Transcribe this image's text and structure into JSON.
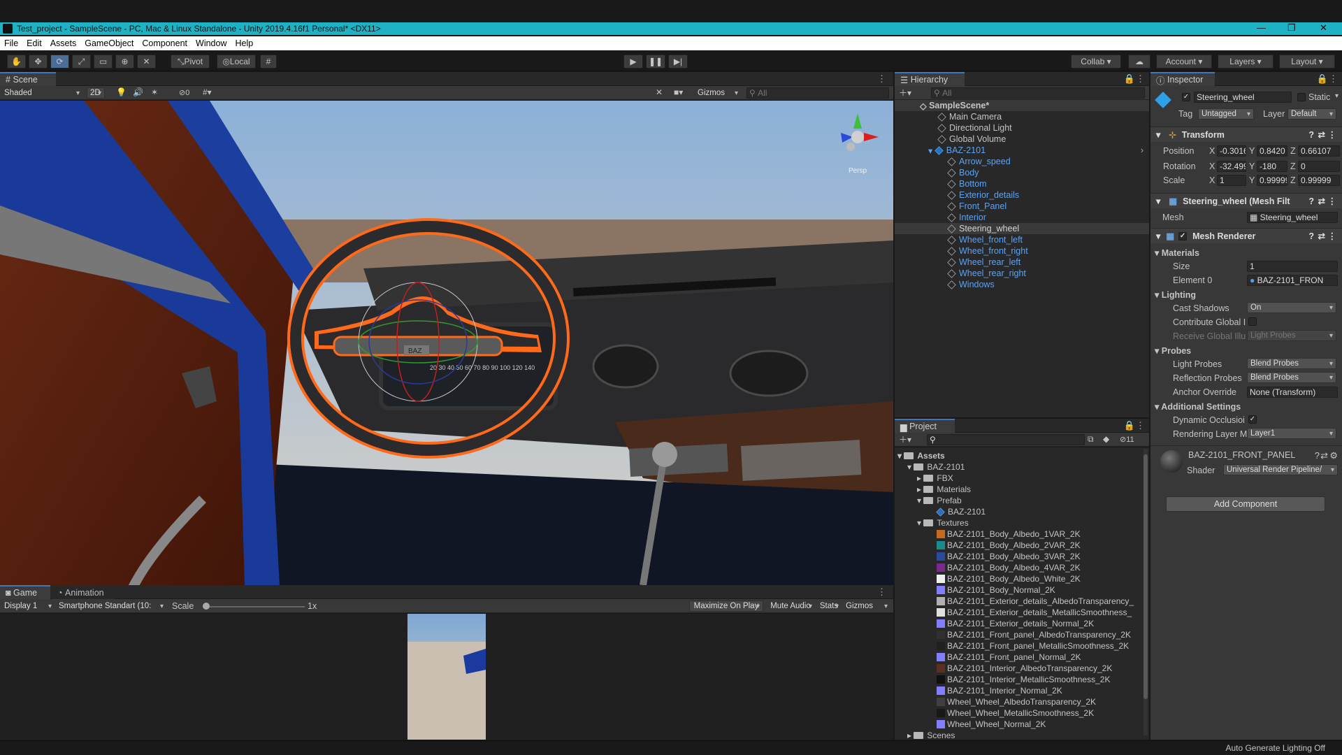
{
  "window": {
    "title": "Test_project - SampleScene - PC, Mac & Linux Standalone - Unity 2019.4.16f1 Personal* <DX11>"
  },
  "menu": [
    "File",
    "Edit",
    "Assets",
    "GameObject",
    "Component",
    "Window",
    "Help"
  ],
  "toolbar": {
    "pivot": "Pivot",
    "local": "Local",
    "collab": "Collab",
    "account": "Account",
    "layers": "Layers",
    "layout": "Layout"
  },
  "scene": {
    "tab": "Scene",
    "shading": "Shaded",
    "mode2d": "2D",
    "hidden_count": "0",
    "gizmos": "Gizmos",
    "search_placeholder": "All",
    "persp": "Persp",
    "speedo": "20 30 40 50 60 70 80 90 100 120 140",
    "badge": "BAZ"
  },
  "game": {
    "tabs": [
      "Game",
      "Animation"
    ],
    "display": "Display 1",
    "resolution": "Smartphone Standart (10:",
    "scale_label": "Scale",
    "scale_value": "1x",
    "scale_fraction": 0.0,
    "buttons": [
      "Maximize On Play",
      "Mute Audio",
      "Stats",
      "Gizmos"
    ]
  },
  "hierarchy": {
    "tab": "Hierarchy",
    "search_placeholder": "All",
    "scene": "SampleScene*",
    "roots": [
      "Main Camera",
      "Directional Light",
      "Global Volume"
    ],
    "prefab": "BAZ-2101",
    "children": [
      "Arrow_speed",
      "Body",
      "Bottom",
      "Exterior_details",
      "Front_Panel",
      "Interior",
      "Steering_wheel",
      "Wheel_front_left",
      "Wheel_front_right",
      "Wheel_rear_left",
      "Wheel_rear_right",
      "Windows"
    ],
    "selected_index": 6
  },
  "project": {
    "tab": "Project",
    "hidden_count": "11",
    "assets": "Assets",
    "baz": "BAZ-2101",
    "folders": [
      "FBX",
      "Materials",
      "Prefab"
    ],
    "prefab_item": "BAZ-2101",
    "textures": "Textures",
    "texture_files": [
      {
        "name": "BAZ-2101_Body_Albedo_1VAR_2K",
        "color": "#c86a1e"
      },
      {
        "name": "BAZ-2101_Body_Albedo_2VAR_2K",
        "color": "#1a8a8a"
      },
      {
        "name": "BAZ-2101_Body_Albedo_3VAR_2K",
        "color": "#2a4a9a"
      },
      {
        "name": "BAZ-2101_Body_Albedo_4VAR_2K",
        "color": "#7a2a8a"
      },
      {
        "name": "BAZ-2101_Body_Albedo_White_2K",
        "color": "#f0f0f0"
      },
      {
        "name": "BAZ-2101_Body_Normal_2K",
        "color": "#8080ff"
      },
      {
        "name": "BAZ-2101_Exterior_details_AlbedoTransparency_",
        "color": "#b0b0b0"
      },
      {
        "name": "BAZ-2101_Exterior_details_MetallicSmoothness_",
        "color": "#e0e0e0"
      },
      {
        "name": "BAZ-2101_Exterior_details_Normal_2K",
        "color": "#8080ff"
      },
      {
        "name": "BAZ-2101_Front_panel_AlbedoTransparency_2K",
        "color": "#303030"
      },
      {
        "name": "BAZ-2101_Front_panel_MetallicSmoothness_2K",
        "color": "#202020"
      },
      {
        "name": "BAZ-2101_Front_panel_Normal_2K",
        "color": "#8080ff"
      },
      {
        "name": "BAZ-2101_Interior_AlbedoTransparency_2K",
        "color": "#5a3020"
      },
      {
        "name": "BAZ-2101_Interior_MetallicSmoothness_2K",
        "color": "#101010"
      },
      {
        "name": "BAZ-2101_Interior_Normal_2K",
        "color": "#8080ff"
      },
      {
        "name": "Wheel_Wheel_AlbedoTransparency_2K",
        "color": "#404040"
      },
      {
        "name": "Wheel_Wheel_MetallicSmoothness_2K",
        "color": "#181818"
      },
      {
        "name": "Wheel_Wheel_Normal_2K",
        "color": "#8080ff"
      }
    ],
    "scenes": "Scenes"
  },
  "inspector": {
    "tab": "Inspector",
    "name": "Steering_wheel",
    "static": "Static",
    "tag_label": "Tag",
    "tag": "Untagged",
    "layer_label": "Layer",
    "layer": "Default",
    "transform": {
      "title": "Transform",
      "position": {
        "label": "Position",
        "x": "-0.3016",
        "y": "0.8420",
        "z": "0.66107"
      },
      "rotation": {
        "label": "Rotation",
        "x": "-32.499",
        "y": "-180",
        "z": "0"
      },
      "scale": {
        "label": "Scale",
        "x": "1",
        "y": "0.99999",
        "z": "0.99999"
      }
    },
    "meshfilter": {
      "title": "Steering_wheel (Mesh Filt",
      "mesh_label": "Mesh",
      "mesh": "Steering_wheel"
    },
    "renderer": {
      "title": "Mesh Renderer",
      "materials": "Materials",
      "size_label": "Size",
      "size": "1",
      "element_label": "Element 0",
      "element": "BAZ-2101_FRON",
      "lighting": "Lighting",
      "cast_label": "Cast Shadows",
      "cast": "On",
      "contrib_label": "Contribute Global I",
      "receive_label": "Receive Global Illu",
      "receive": "Light Probes",
      "probes": "Probes",
      "lightprobes_label": "Light Probes",
      "lightprobes": "Blend Probes",
      "reflection_label": "Reflection Probes",
      "reflection": "Blend Probes",
      "anchor_label": "Anchor Override",
      "anchor": "None (Transform)",
      "additional": "Additional Settings",
      "dynocc_label": "Dynamic Occlusioi",
      "renderlayer_label": "Rendering Layer M",
      "renderlayer": "Layer1"
    },
    "material": {
      "name": "BAZ-2101_FRONT_PANEL",
      "shader_label": "Shader",
      "shader": "Universal Render Pipeline/"
    },
    "add_component": "Add Component"
  },
  "status": {
    "text": "Auto Generate Lighting Off"
  }
}
